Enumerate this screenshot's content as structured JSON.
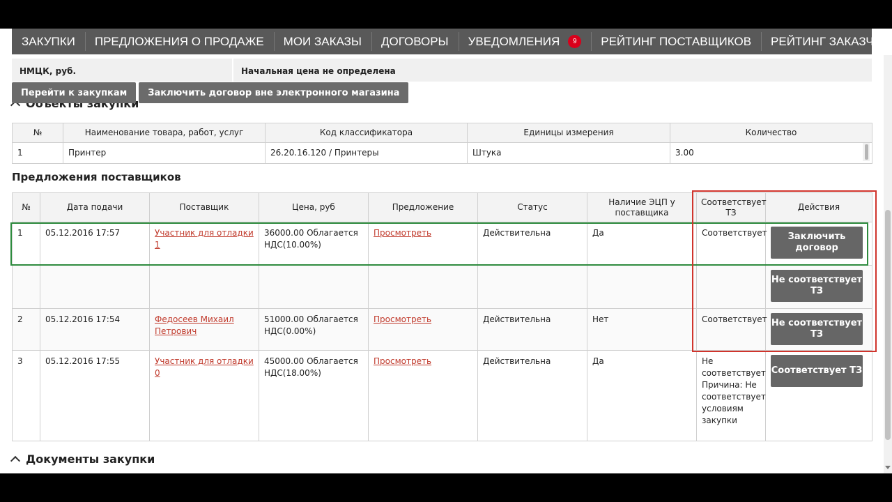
{
  "nav": {
    "items": [
      {
        "label": "ЗАКУПКИ"
      },
      {
        "label": "ПРЕДЛОЖЕНИЯ О ПРОДАЖЕ"
      },
      {
        "label": "МОИ ЗАКАЗЫ"
      },
      {
        "label": "ДОГОВОРЫ"
      },
      {
        "label": "УВЕДОМЛЕНИЯ",
        "badge": "9"
      },
      {
        "label": "РЕЙТИНГ ПОСТАВЩИКОВ"
      },
      {
        "label": "РЕЙТИНГ ЗАКАЗЧИКОВ"
      }
    ],
    "badge_color": "#d9001b"
  },
  "nmck": {
    "label": "НМЦК, руб.",
    "value": "Начальная цена не определена"
  },
  "buttons": {
    "go_to_purchases": "Перейти к закупкам",
    "contract_outside": "Заключить договор вне электронного магазина"
  },
  "sections": {
    "objects": "Объекты закупки",
    "offers": "Предложения поставщиков",
    "documents": "Документы закупки"
  },
  "items_table": {
    "headers": [
      "№",
      "Наименование товара, работ, услуг",
      "Код классификатора",
      "Единицы измерения",
      "Количество"
    ],
    "rows": [
      [
        "1",
        "Принтер",
        "26.20.16.120 / Принтеры",
        "Штука",
        "3.00"
      ]
    ]
  },
  "offers_table": {
    "headers": [
      "№",
      "Дата подачи",
      "Поставщик",
      "Цена, руб",
      "Предложение",
      "Статус",
      "Наличие ЭЦП у поставщика",
      "Соответствует ТЗ",
      "Действия"
    ],
    "rows": [
      {
        "num": "1",
        "date": "05.12.2016 17:57",
        "supplier": "Участник для отладки 1",
        "price": "36000.00 Облагается НДС(10.00%)",
        "offer": "Просмотреть",
        "status": "Действительна",
        "ecp": "Да",
        "tz": "Соответствует",
        "action": "Заключить договор"
      },
      {
        "num": "",
        "date": "",
        "supplier": "",
        "price": "",
        "offer": "",
        "status": "",
        "ecp": "",
        "tz": "",
        "action": "Не соответствует ТЗ"
      },
      {
        "num": "2",
        "date": "05.12.2016 17:54",
        "supplier": "Федосеев Михаил Петрович",
        "price": "51000.00 Облагается НДС(0.00%)",
        "offer": "Просмотреть",
        "status": "Действительна",
        "ecp": "Нет",
        "tz": "Соответствует",
        "action": "Не соответствует ТЗ"
      },
      {
        "num": "3",
        "date": "05.12.2016 17:55",
        "supplier": "Участник для отладки 0",
        "price": "45000.00 Облагается НДС(18.00%)",
        "offer": "Просмотреть",
        "status": "Действительна",
        "ecp": "Да",
        "tz": "Не соответствует Причина: Не соответствует условиям закупки",
        "action": "Соответствует ТЗ"
      }
    ]
  },
  "colors": {
    "nav_bg": "#595959",
    "link": "#c0392b",
    "highlight_green": "#2e8b3e",
    "highlight_red": "#d0342c"
  }
}
